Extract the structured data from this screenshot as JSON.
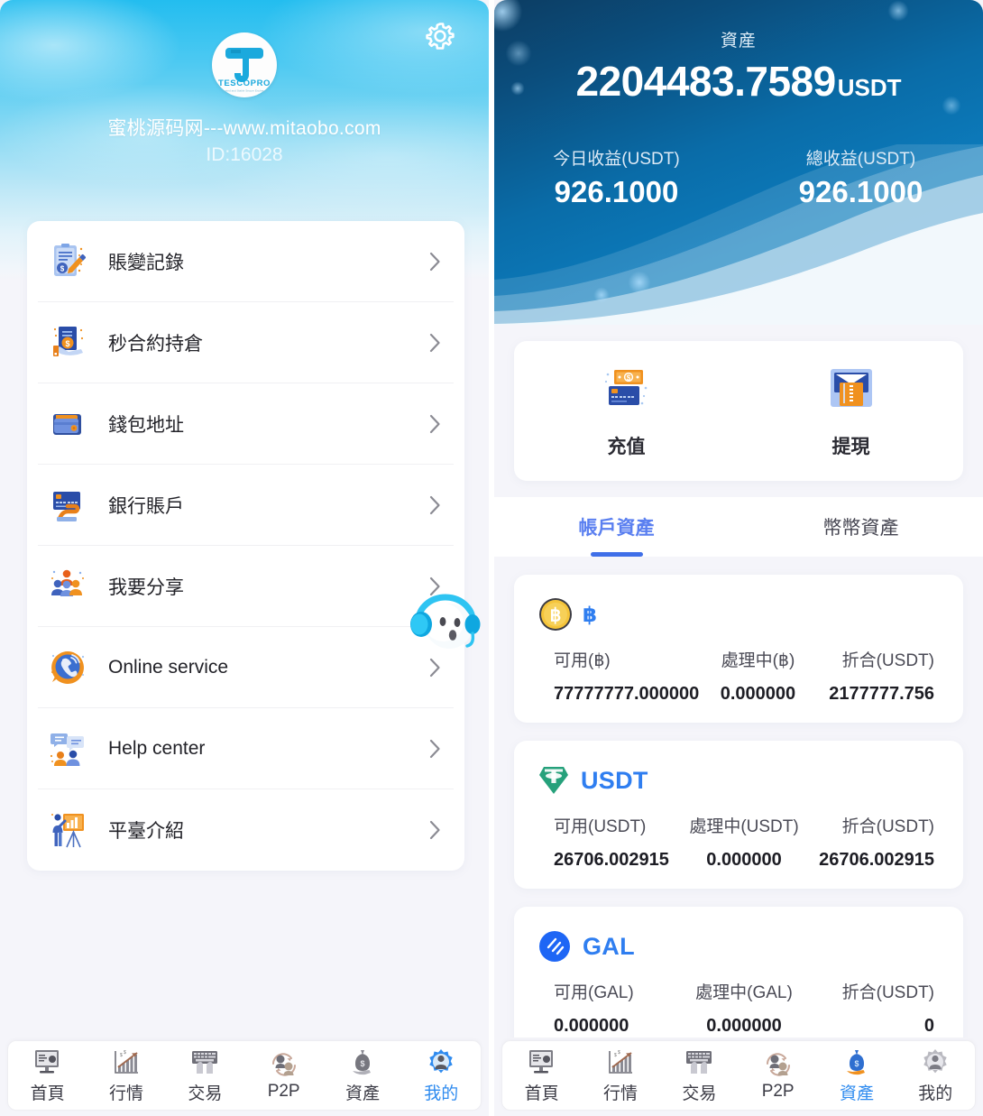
{
  "left_panel": {
    "header": {
      "gear_icon": "gear-icon",
      "logo_text": "TESCOPRO",
      "logo_tagline": "Trusted and Stable Secure Exchange",
      "site_name": "蜜桃源码网---www.mitaobo.com",
      "user_id": "ID:16028"
    },
    "menu": [
      {
        "label": "賬變記錄",
        "icon": "ledger-record-icon"
      },
      {
        "label": "秒合約持倉",
        "icon": "contract-position-icon"
      },
      {
        "label": "錢包地址",
        "icon": "wallet-address-icon"
      },
      {
        "label": "銀行賬戶",
        "icon": "bank-account-icon"
      },
      {
        "label": "我要分享",
        "icon": "share-people-icon"
      },
      {
        "label": "Online service",
        "icon": "online-service-icon"
      },
      {
        "label": "Help center",
        "icon": "help-center-icon"
      },
      {
        "label": "平臺介紹",
        "icon": "platform-intro-icon"
      }
    ],
    "service_bubble": "headset-mascot-icon",
    "bottom_nav": {
      "active": "我的",
      "items": [
        {
          "label": "首頁",
          "icon": "home-monitor-icon"
        },
        {
          "label": "行情",
          "icon": "market-chart-icon"
        },
        {
          "label": "交易",
          "icon": "trade-keyboard-icon"
        },
        {
          "label": "P2P",
          "icon": "p2p-people-icon"
        },
        {
          "label": "資產",
          "icon": "assets-bag-icon"
        },
        {
          "label": "我的",
          "icon": "profile-gear-icon"
        }
      ]
    }
  },
  "right_panel": {
    "hero": {
      "asset_label": "資産",
      "asset_amount": "2204483.7589",
      "asset_unit": "USDT",
      "today_profit_title": "今日收益(USDT)",
      "today_profit_value": "926.1000",
      "total_profit_title": "總收益(USDT)",
      "total_profit_value": "926.1000"
    },
    "actions": [
      {
        "label": "充值",
        "icon": "deposit-money-icon"
      },
      {
        "label": "提現",
        "icon": "withdraw-card-icon"
      }
    ],
    "tabs": [
      {
        "label": "帳戶資產",
        "active": true
      },
      {
        "label": "幣幣資產",
        "active": false
      }
    ],
    "coins": [
      {
        "symbol": "฿",
        "icon": "bitcoin-coin-icon",
        "symbol_style": "small",
        "available_title": "可用(฿)",
        "available_value": "77777777.000000",
        "processing_title": "處理中(฿)",
        "processing_value": "0.000000",
        "converted_title": "折合(USDT)",
        "converted_value": "2177777.756"
      },
      {
        "symbol": "USDT",
        "icon": "tether-icon",
        "symbol_style": "normal",
        "available_title": "可用(USDT)",
        "available_value": "26706.002915",
        "processing_title": "處理中(USDT)",
        "processing_value": "0.000000",
        "converted_title": "折合(USDT)",
        "converted_value": "26706.002915"
      },
      {
        "symbol": "GAL",
        "icon": "gal-coin-icon",
        "symbol_style": "normal",
        "available_title": "可用(GAL)",
        "available_value": "0.000000",
        "processing_title": "處理中(GAL)",
        "processing_value": "0.000000",
        "converted_title": "折合(USDT)",
        "converted_value": "0"
      }
    ],
    "service_bubble": "headset-mascot-icon",
    "bottom_nav": {
      "active": "資產",
      "items": [
        {
          "label": "首頁",
          "icon": "home-monitor-icon"
        },
        {
          "label": "行情",
          "icon": "market-chart-icon"
        },
        {
          "label": "交易",
          "icon": "trade-keyboard-icon"
        },
        {
          "label": "P2P",
          "icon": "p2p-people-icon"
        },
        {
          "label": "資產",
          "icon": "assets-bag-icon"
        },
        {
          "label": "我的",
          "icon": "profile-gear-icon"
        }
      ]
    }
  },
  "colors": {
    "left_hero_top": "#23bdef",
    "right_hero_dark": "#0c3d63",
    "right_hero_light": "#1186c6",
    "accent_blue": "#2f7ef0",
    "tab_active": "#3f6fe8",
    "page_bg": "#f5f5fa"
  }
}
